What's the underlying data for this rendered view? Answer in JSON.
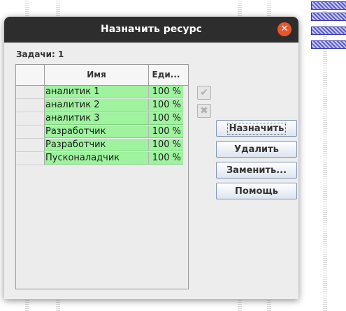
{
  "dialog": {
    "title": "Назначить ресурс",
    "close_icon": "close-icon",
    "tasks_label": "Задачи: 1"
  },
  "table": {
    "columns": [
      "Имя",
      "Еди..."
    ],
    "rows": [
      {
        "name": "аналитик 1",
        "unit": "100 %"
      },
      {
        "name": "аналитик 2",
        "unit": "100 %"
      },
      {
        "name": "аналитик 3",
        "unit": "100 %"
      },
      {
        "name": "Разработчик",
        "unit": "100 %"
      },
      {
        "name": "Разработчик",
        "unit": "100 %"
      },
      {
        "name": "Пусконаладчик",
        "unit": "100 %"
      }
    ],
    "row_color": "#9ff39f"
  },
  "icons": {
    "check": "check-icon",
    "remove": "x-icon"
  },
  "buttons": {
    "assign": "Назначить",
    "delete": "Удалить",
    "replace": "Заменить...",
    "help": "Помощь"
  },
  "colors": {
    "titlebar": "#2d2d2d",
    "close": "#e8572c",
    "dialog_bg": "#ededed"
  }
}
